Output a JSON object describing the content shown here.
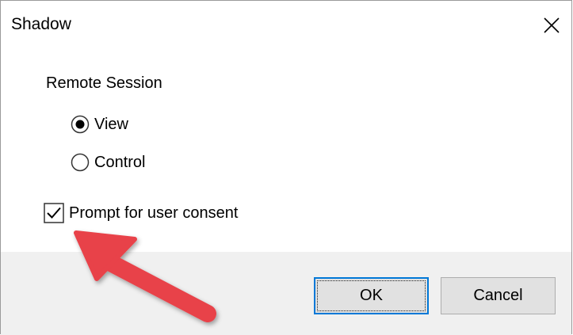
{
  "window": {
    "title": "Shadow",
    "close_icon": "close-icon"
  },
  "remote_session": {
    "label": "Remote Session",
    "options": [
      {
        "label": "View",
        "selected": true
      },
      {
        "label": "Control",
        "selected": false
      }
    ]
  },
  "consent": {
    "label": "Prompt for user consent",
    "checked": true
  },
  "buttons": {
    "ok_label": "OK",
    "cancel_label": "Cancel"
  },
  "colors": {
    "annotation_arrow": "#e8424a",
    "default_button_border": "#0078d7",
    "footer_background": "#f0f0f0"
  }
}
